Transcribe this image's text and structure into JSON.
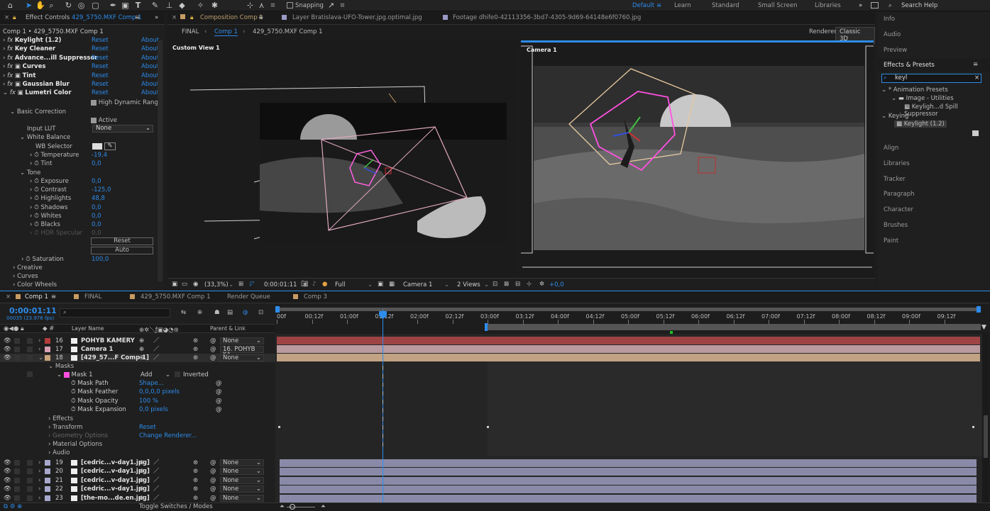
{
  "toolbar": {
    "snapping": "Snapping",
    "workspaces": [
      "Default",
      "Learn",
      "Standard",
      "Small Screen",
      "Libraries"
    ],
    "search_placeholder": "Search Help"
  },
  "left_panel": {
    "tab": "Effect Controls",
    "tab_target": "429_5750.MXF Comp 1",
    "breadcrumb": "Comp 1 • 429_5750.MXF Comp 1",
    "effects": [
      {
        "name": "Keylight (1.2)",
        "reset": "Reset",
        "about": "About"
      },
      {
        "name": "Key Cleaner",
        "reset": "Reset",
        "about": "About"
      },
      {
        "name": "Advance...ill Suppressor",
        "reset": "Reset",
        "about": "About"
      },
      {
        "name": "Curves",
        "reset": "Reset",
        "about": "About"
      },
      {
        "name": "Tint",
        "reset": "Reset",
        "about": "About"
      },
      {
        "name": "Gaussian Blur",
        "reset": "Reset",
        "about": "About"
      },
      {
        "name": "Lumetri Color",
        "reset": "Reset",
        "about": "About"
      }
    ],
    "hdr_label": "High Dynamic Rang",
    "basic_correction": "Basic Correction",
    "active_label": "Active",
    "input_lut_label": "Input LUT",
    "input_lut_value": "None",
    "white_balance": "White Balance",
    "wb_selector": "WB Selector",
    "temperature_label": "Temperature",
    "temperature_value": "-19,4",
    "tint_label": "Tint",
    "tint_value": "0,0",
    "tone": "Tone",
    "exposure_label": "Exposure",
    "exposure_value": "0,0",
    "contrast_label": "Contrast",
    "contrast_value": "-125,0",
    "highlights_label": "Highlights",
    "highlights_value": "48,8",
    "shadows_label": "Shadows",
    "shadows_value": "0,0",
    "whites_label": "Whites",
    "whites_value": "0,0",
    "blacks_label": "Blacks",
    "blacks_value": "0,0",
    "hdr_specular_label": "HDR Specular",
    "hdr_specular_value": "0,0",
    "reset_button": "Reset",
    "auto_button": "Auto",
    "saturation_label": "Saturation",
    "saturation_value": "100,0",
    "creative": "Creative",
    "curves": "Curves",
    "color_wheels": "Color Wheels"
  },
  "comp_panel": {
    "tabs": [
      "Composition Comp 1",
      "Layer Bratislava-UFO-Tower.jpg.optimal.jpg",
      "Footage dhife0-42113356-3bd7-4305-9d69-64148e6f0760.jpg"
    ],
    "flow": [
      "FINAL",
      "Comp 1",
      "429_5750.MXF Comp 1"
    ],
    "renderer_label": "Renderer:",
    "renderer_value": "Classic 3D",
    "view_left": "Custom View 1",
    "view_right": "Camera 1",
    "bottom": {
      "zoom": "(33,3%)",
      "timecode": "0:00:01:11",
      "resolution": "Full",
      "camera": "Camera 1",
      "views": "2 Views",
      "exposure": "+0,0"
    }
  },
  "right_panel": {
    "items_top": [
      "Info",
      "Audio",
      "Preview"
    ],
    "effects_presets": "Effects & Presets",
    "search_value": "keyl",
    "tree": [
      "* Animation Presets",
      "Image - Utilities",
      "Keyligh...d Spill Suppressor",
      "Keying",
      "Keylight (1.2)"
    ],
    "items_bottom": [
      "Align",
      "Libraries",
      "Tracker",
      "Paragraph",
      "Character",
      "Brushes",
      "Paint"
    ]
  },
  "timeline": {
    "tabs": [
      "Comp 1",
      "FINAL",
      "429_5750.MXF Comp 1",
      "Render Queue",
      "Comp 3"
    ],
    "timecode": "0:00:01:11",
    "frame_info": "00035 (23.976 fps)",
    "header_layer_name": "Layer Name",
    "header_parent": "Parent & Link",
    "ruler": [
      "00f",
      "00:12f",
      "01:00f",
      "01:12f",
      "02:00f",
      "02:12f",
      "03:00f",
      "03:12f",
      "04:00f",
      "04:12f",
      "05:00f",
      "05:12f",
      "06:00f",
      "06:12f",
      "07:00f",
      "07:12f",
      "08:00f",
      "08:12f",
      "09:00f",
      "09:12f"
    ],
    "layers_top": [
      {
        "num": "16",
        "name": "POHYB KAMERY",
        "parent": "None",
        "color": "#b33c3c"
      },
      {
        "num": "17",
        "name": "Camera 1",
        "parent": "16. POHYB KA",
        "color": "#d8a0b0"
      },
      {
        "num": "18",
        "name": "[429_57...F Comp 1]",
        "parent": "None",
        "color": "#c9a47a"
      }
    ],
    "masks_label": "Masks",
    "mask1_label": "Mask 1",
    "mask_mode": "Add",
    "inverted_label": "Inverted",
    "mask_props": [
      {
        "name": "Mask Path",
        "value": "Shape..."
      },
      {
        "name": "Mask Feather",
        "value": "0,0,0,0 pixels"
      },
      {
        "name": "Mask Opacity",
        "value": "100 %"
      },
      {
        "name": "Mask Expansion",
        "value": "0,0 pixels"
      }
    ],
    "effects_label": "Effects",
    "transform_label": "Transform",
    "transform_reset": "Reset",
    "geometry_label": "Geometry Options",
    "geometry_value": "Change Renderer...",
    "material_label": "Material Options",
    "audio_label": "Audio",
    "layers_bottom": [
      {
        "num": "19",
        "name": "[cedric...v-day1.jpg]",
        "parent": "None"
      },
      {
        "num": "20",
        "name": "[cedric...v-day1.jpg]",
        "parent": "None"
      },
      {
        "num": "21",
        "name": "[cedric...v-day1.jpg]",
        "parent": "None"
      },
      {
        "num": "22",
        "name": "[cedric...v-day1.jpg]",
        "parent": "None"
      },
      {
        "num": "23",
        "name": "[the-mo...de.en.jpg]",
        "parent": "None"
      }
    ],
    "toggle_label": "Toggle Switches / Modes"
  }
}
